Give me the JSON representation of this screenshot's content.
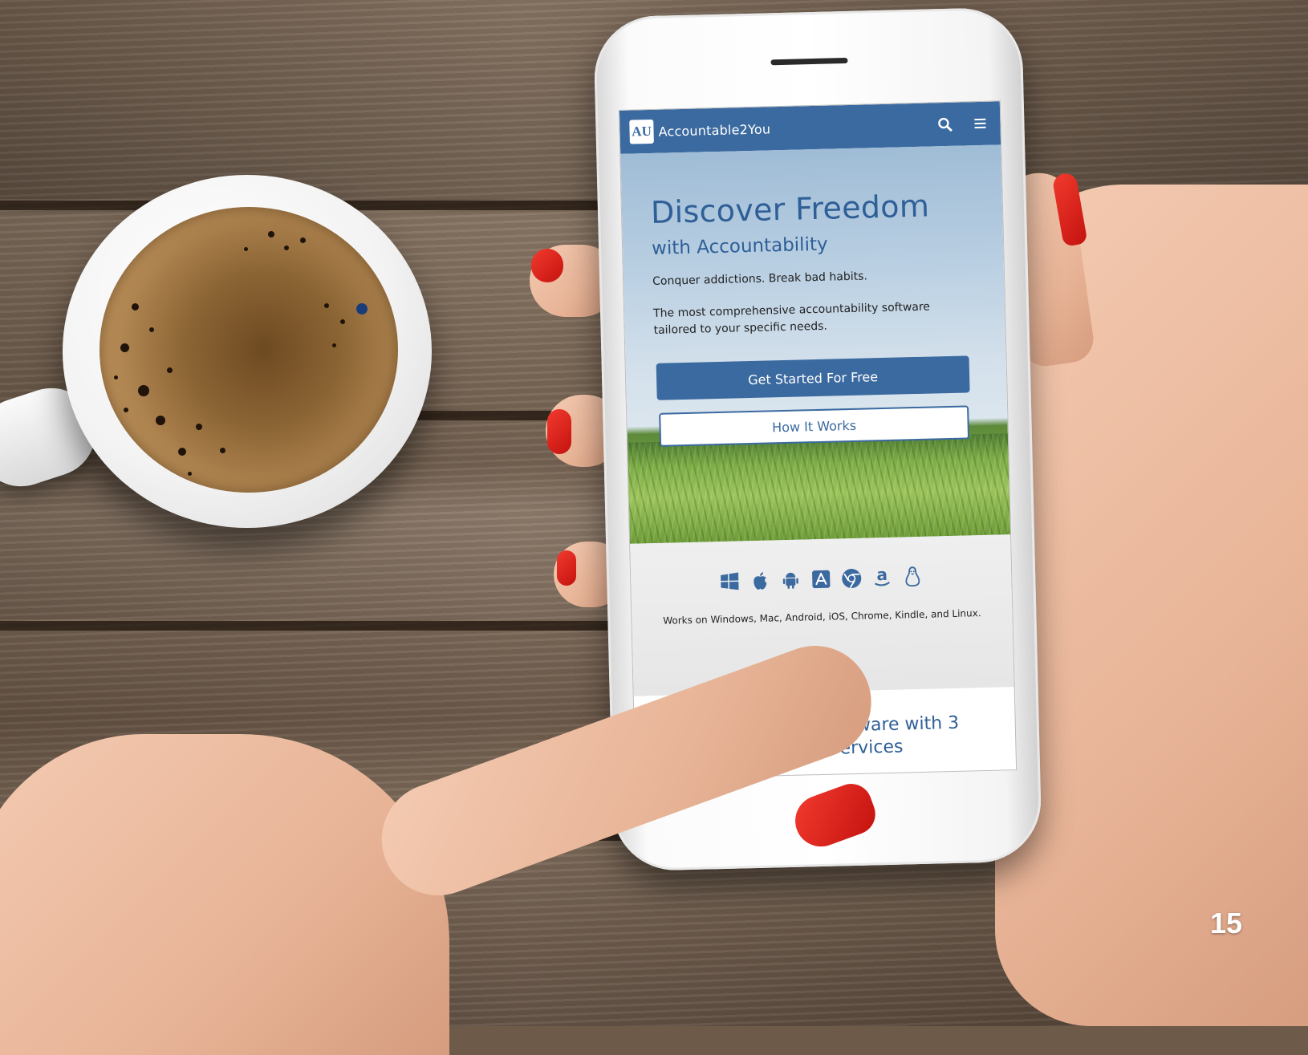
{
  "nav": {
    "logo_mark": "AU",
    "brand": "Accountable2You",
    "search_icon": "search-icon",
    "menu_icon": "hamburger-menu-icon"
  },
  "hero": {
    "title": "Discover Freedom",
    "subtitle": "with Accountability",
    "line1": "Conquer addictions. Break bad habits.",
    "line2": "The most comprehensive accountability software tailored to your specific needs.",
    "primary_button": "Get Started For Free",
    "secondary_button": "How It Works"
  },
  "platforms": {
    "icons": [
      "windows-icon",
      "apple-icon",
      "android-icon",
      "app-store-icon",
      "chrome-icon",
      "amazon-icon",
      "linux-icon"
    ],
    "caption": "Works on Windows, Mac, Android, iOS, Chrome, Kindle, and Linux."
  },
  "section": {
    "title": "Accountability Software with 3 Powerful Services"
  },
  "page_number": "15",
  "colors": {
    "brand_blue": "#3b6aa0",
    "heading_blue": "#2f5f97"
  }
}
